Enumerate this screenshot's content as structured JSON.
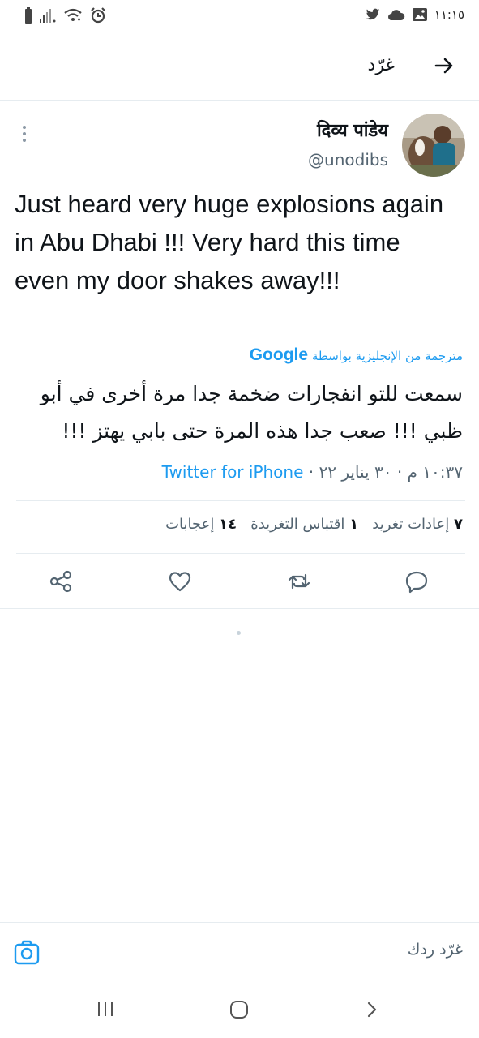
{
  "status_bar": {
    "time": "١١:١٥",
    "left_icons": [
      "battery-icon",
      "signal-icon",
      "wifi-icon",
      "alarm-icon"
    ],
    "right_icons": [
      "twitter-bird-icon",
      "cloud-icon",
      "image-icon"
    ]
  },
  "header": {
    "title": "غرّد",
    "back_icon": "arrow-right-icon"
  },
  "tweet": {
    "author_name": "दिव्य पांडेय",
    "author_handle": "@unodibs",
    "text": "Just heard very huge explosions again in Abu Dhabi !!! Very hard this time even my door shakes away!!!",
    "translated_by_prefix": "مترجمة من الإنجليزية بواسطة",
    "translated_by_brand": "Google",
    "translation": "سمعت للتو انفجارات ضخمة جدا مرة أخرى في أبو ظبي !!! صعب جدا هذه المرة حتى بابي يهتز !!!",
    "timestamp": "١٠:٣٧ م · ٣٠ يناير ٢٢ ·",
    "source": "Twitter for iPhone",
    "retweets_count": "٧",
    "retweets_label": "إعادات تغريد",
    "quotes_count": "١",
    "quotes_label": "اقتباس التغريدة",
    "likes_count": "١٤",
    "likes_label": "إعجابات"
  },
  "actions": [
    "reply-icon",
    "retweet-icon",
    "like-icon",
    "share-icon"
  ],
  "reply_bar": {
    "placeholder": "غرّد ردك",
    "camera_icon": "camera-icon"
  },
  "nav_bar": {
    "items": [
      "recent-apps-icon",
      "home-icon",
      "back-icon"
    ]
  },
  "colors": {
    "accent": "#1d9bf0",
    "text": "#0f1419",
    "secondary_text": "#536471",
    "divider": "#e6ecf0"
  }
}
